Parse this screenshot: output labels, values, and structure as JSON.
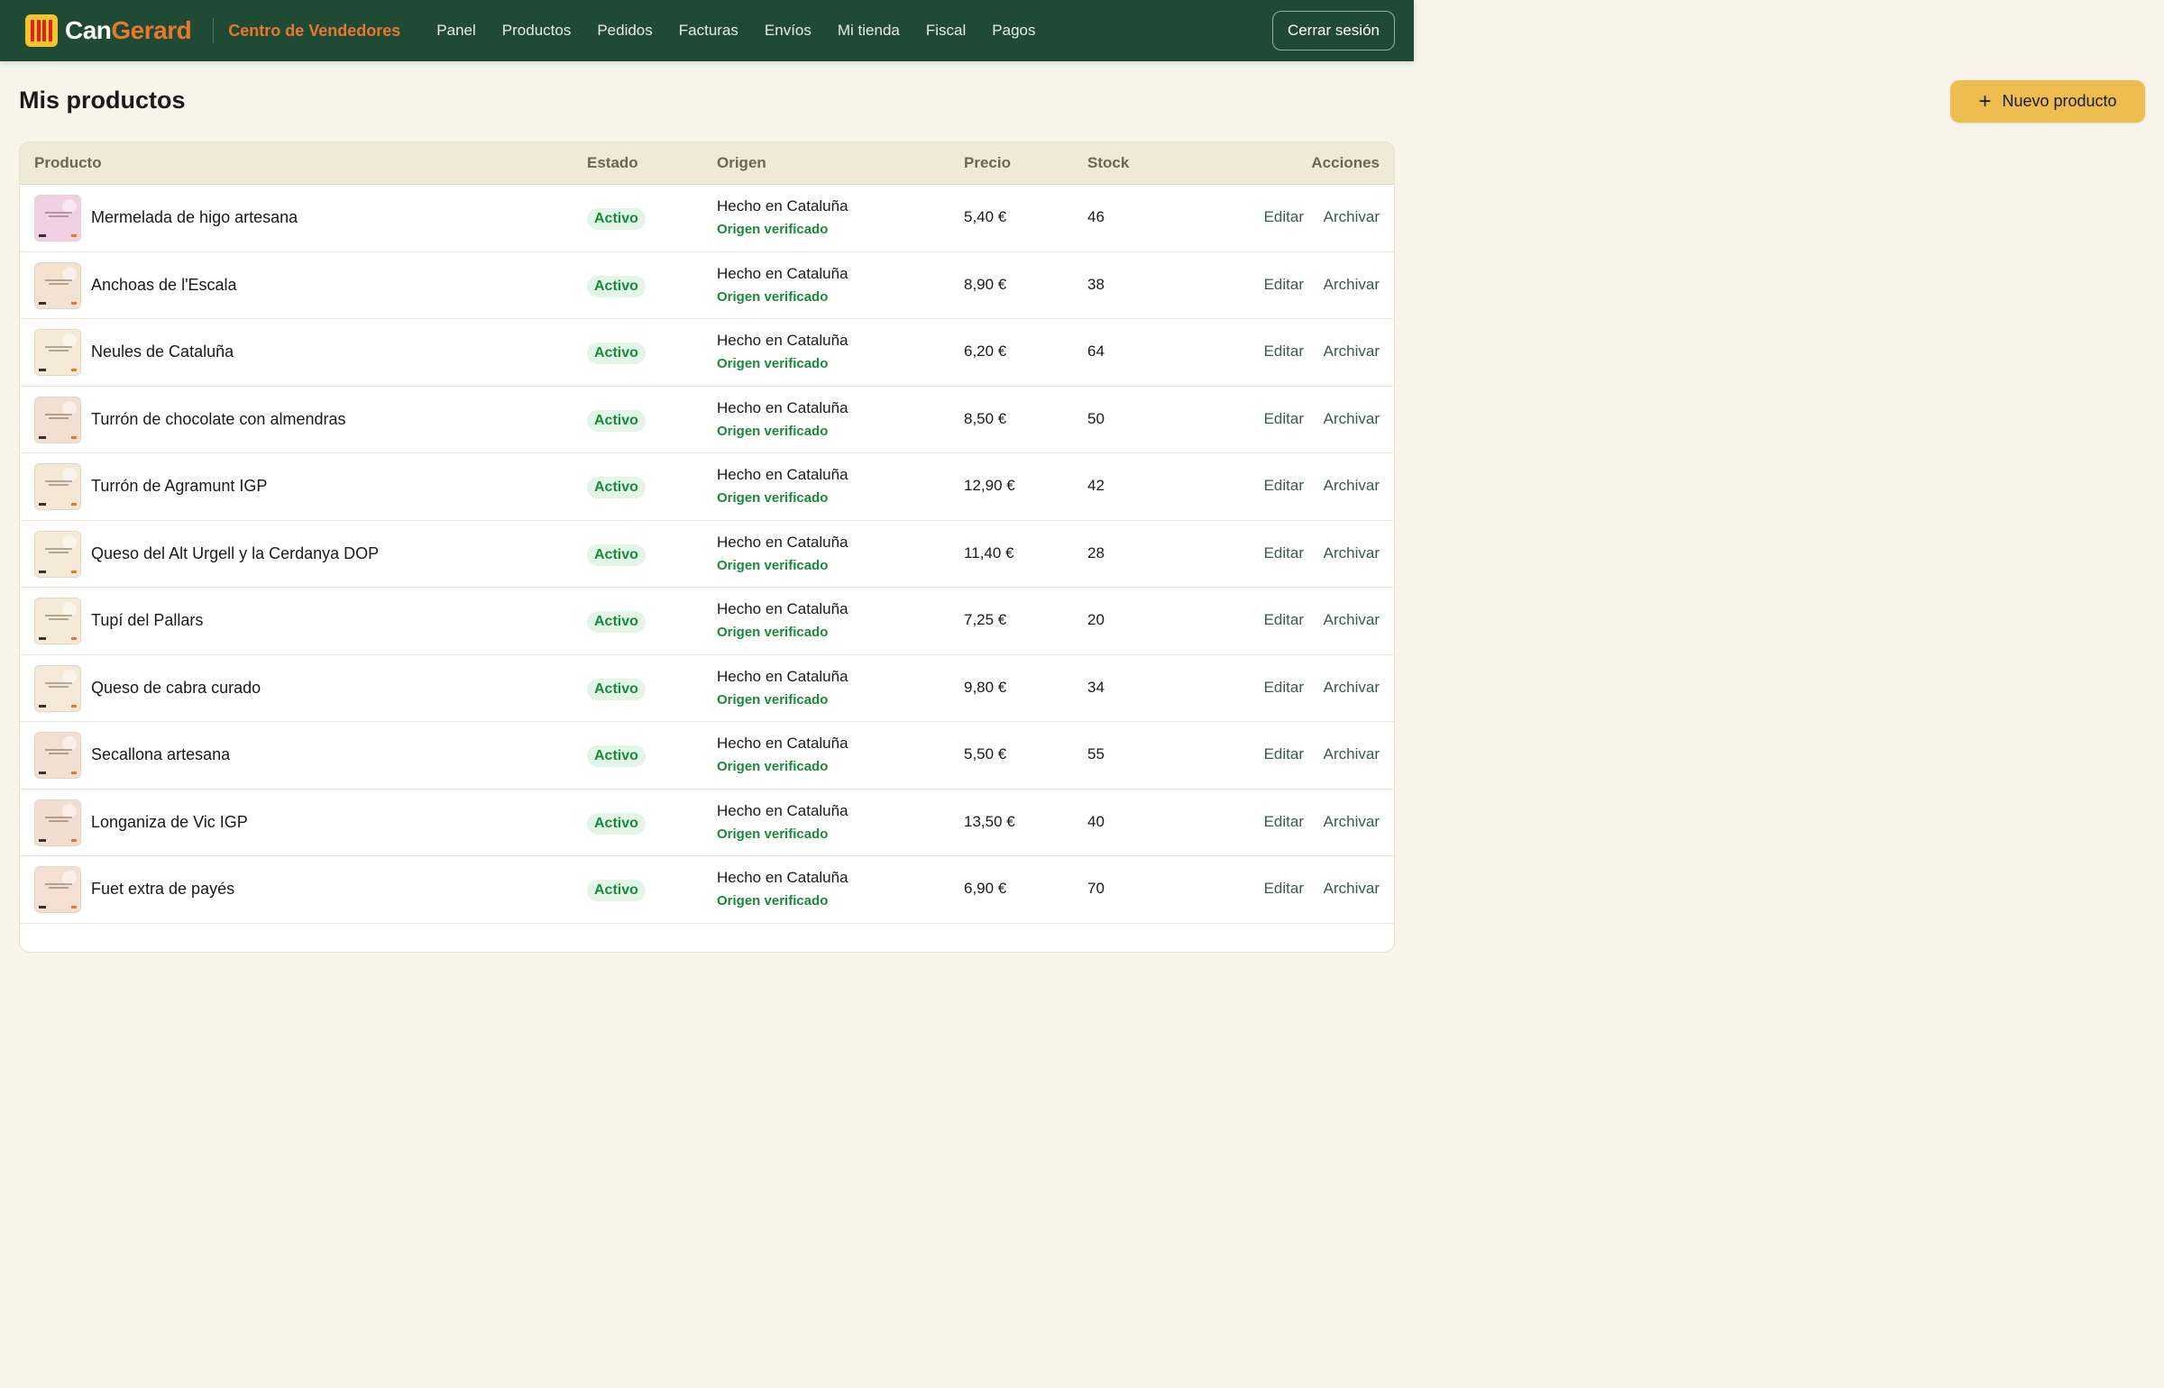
{
  "brand": {
    "can": "Can",
    "gerard": "Gerard",
    "subtitle": "Centro de Vendedores"
  },
  "nav": [
    "Panel",
    "Productos",
    "Pedidos",
    "Facturas",
    "Envíos",
    "Mi tienda",
    "Fiscal",
    "Pagos"
  ],
  "logout_label": "Cerrar sesión",
  "page_title": "Mis productos",
  "new_product_label": "Nuevo producto",
  "columns": {
    "product": "Producto",
    "status": "Estado",
    "origin": "Origen",
    "price": "Precio",
    "stock": "Stock",
    "actions": "Acciones"
  },
  "actions": {
    "edit": "Editar",
    "archive": "Archivar"
  },
  "products": [
    {
      "name": "Mermelada de higo artesana",
      "status": "Activo",
      "origin": "Hecho en Cataluña",
      "verified": "Origen verificado",
      "price": "5,40 €",
      "stock": "46",
      "thumb_color": "#f1cfe4"
    },
    {
      "name": "Anchoas de l'Escala",
      "status": "Activo",
      "origin": "Hecho en Cataluña",
      "verified": "Origen verificado",
      "price": "8,90 €",
      "stock": "38",
      "thumb_color": "#f3e2d0"
    },
    {
      "name": "Neules de Cataluña",
      "status": "Activo",
      "origin": "Hecho en Cataluña",
      "verified": "Origen verificado",
      "price": "6,20 €",
      "stock": "64",
      "thumb_color": "#f4ead6"
    },
    {
      "name": "Turrón de chocolate con almendras",
      "status": "Activo",
      "origin": "Hecho en Cataluña",
      "verified": "Origen verificado",
      "price": "8,50 €",
      "stock": "50",
      "thumb_color": "#f3dfd2"
    },
    {
      "name": "Turrón de Agramunt IGP",
      "status": "Activo",
      "origin": "Hecho en Cataluña",
      "verified": "Origen verificado",
      "price": "12,90 €",
      "stock": "42",
      "thumb_color": "#f4e7d4"
    },
    {
      "name": "Queso del Alt Urgell y la Cerdanya DOP",
      "status": "Activo",
      "origin": "Hecho en Cataluña",
      "verified": "Origen verificado",
      "price": "11,40 €",
      "stock": "28",
      "thumb_color": "#f4ead6"
    },
    {
      "name": "Tupí del Pallars",
      "status": "Activo",
      "origin": "Hecho en Cataluña",
      "verified": "Origen verificado",
      "price": "7,25 €",
      "stock": "20",
      "thumb_color": "#f4ead6"
    },
    {
      "name": "Queso de cabra curado",
      "status": "Activo",
      "origin": "Hecho en Cataluña",
      "verified": "Origen verificado",
      "price": "9,80 €",
      "stock": "34",
      "thumb_color": "#f4e9d6"
    },
    {
      "name": "Secallona artesana",
      "status": "Activo",
      "origin": "Hecho en Cataluña",
      "verified": "Origen verificado",
      "price": "5,50 €",
      "stock": "55",
      "thumb_color": "#f3dfd2"
    },
    {
      "name": "Longaniza de Vic IGP",
      "status": "Activo",
      "origin": "Hecho en Cataluña",
      "verified": "Origen verificado",
      "price": "13,50 €",
      "stock": "40",
      "thumb_color": "#f3dcd0"
    },
    {
      "name": "Fuet extra de payés",
      "status": "Activo",
      "origin": "Hecho en Cataluña",
      "verified": "Origen verificado",
      "price": "6,90 €",
      "stock": "70",
      "thumb_color": "#f3e0d2"
    }
  ]
}
